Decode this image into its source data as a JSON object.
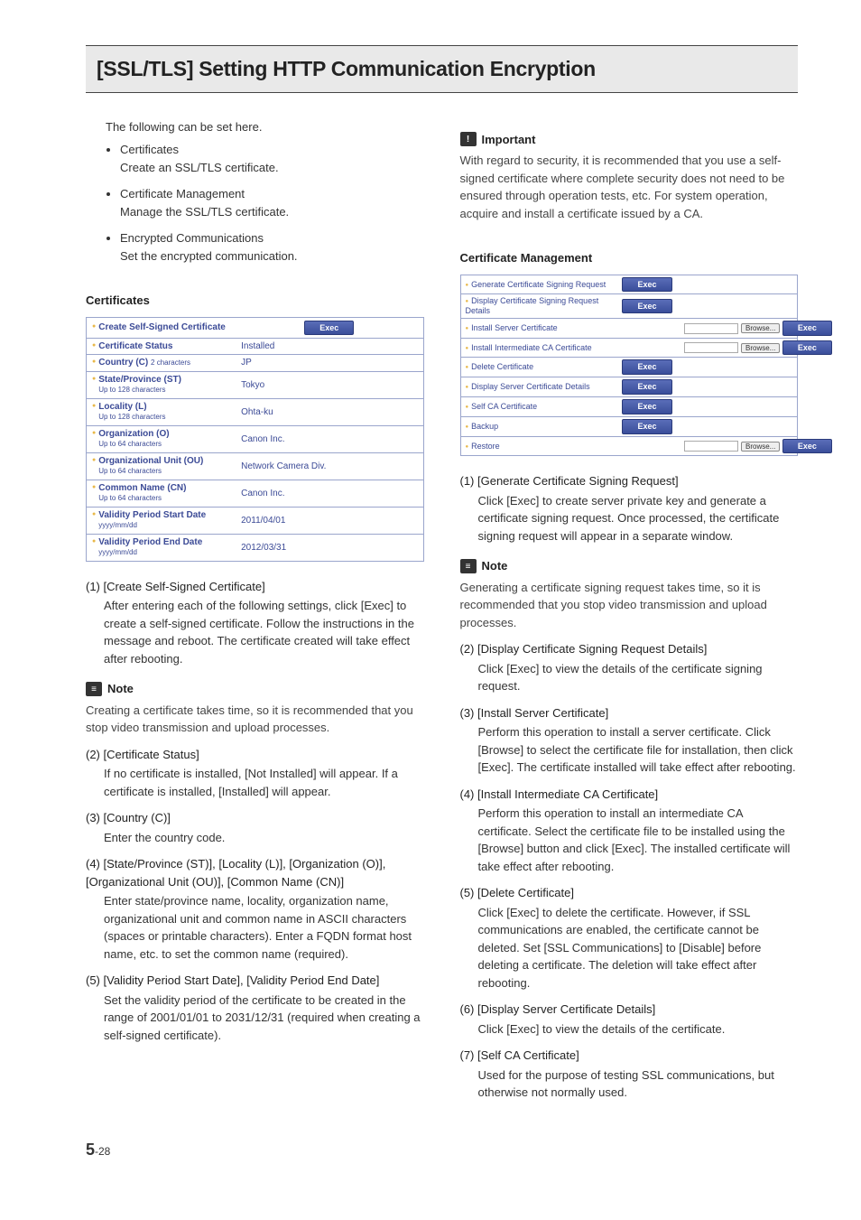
{
  "title": "[SSL/TLS] Setting HTTP Communication Encryption",
  "intro": "The following can be set here.",
  "bullets": [
    {
      "head": "Certificates",
      "sub": "Create an SSL/TLS certificate."
    },
    {
      "head": "Certificate Management",
      "sub": "Manage the SSL/TLS certificate."
    },
    {
      "head": "Encrypted Communications",
      "sub": "Set the encrypted communication."
    }
  ],
  "left": {
    "certificates_head": "Certificates",
    "table": {
      "rows": [
        {
          "label": "Create Self-Signed Certificate",
          "sub": "",
          "exec": true
        },
        {
          "label": "Certificate Status",
          "val": "Installed"
        },
        {
          "label": "Country (C)",
          "sub": "2 characters",
          "val": "JP"
        },
        {
          "label": "State/Province (ST)",
          "sub": "Up to 128 characters",
          "val": "Tokyo"
        },
        {
          "label": "Locality (L)",
          "sub": "Up to 128 characters",
          "val": "Ohta-ku"
        },
        {
          "label": "Organization (O)",
          "sub": "Up to 64 characters",
          "val": "Canon Inc."
        },
        {
          "label": "Organizational Unit (OU)",
          "sub": "Up to 64 characters",
          "val": "Network Camera Div."
        },
        {
          "label": "Common Name (CN)",
          "sub": "Up to 64 characters",
          "val": "Canon Inc."
        },
        {
          "label": "Validity Period Start Date",
          "sub": "yyyy/mm/dd",
          "val": "2011/04/01"
        },
        {
          "label": "Validity Period End Date",
          "sub": "yyyy/mm/dd",
          "val": "2012/03/31"
        }
      ],
      "exec_label": "Exec"
    },
    "items": {
      "i1": {
        "head": "(1) [Create Self-Signed Certificate]",
        "body": "After entering each of the following settings, click [Exec] to create a self-signed certificate. Follow the instructions in the message and reboot. The certificate created will take effect after rebooting."
      },
      "note1": {
        "title": "Note",
        "body": "Creating a certificate takes time, so it is recommended that you stop video transmission and upload processes."
      },
      "i2": {
        "head": "(2) [Certificate Status]",
        "body": "If no certificate is installed, [Not Installed] will appear. If a certificate is installed, [Installed] will appear."
      },
      "i3": {
        "head": "(3) [Country (C)]",
        "body": "Enter the country code."
      },
      "i4": {
        "head": "(4) [State/Province (ST)], [Locality (L)], [Organization (O)], [Organizational Unit (OU)], [Common Name (CN)]",
        "body": "Enter state/province name, locality, organization name, organizational unit and common name in ASCII characters (spaces or printable characters). Enter a FQDN format host name, etc. to set the common name (required)."
      },
      "i5": {
        "head": "(5) [Validity Period Start Date], [Validity Period End Date]",
        "body": "Set the validity period of the certificate to be created in the range of 2001/01/01 to 2031/12/31 (required when creating a self-signed certificate)."
      }
    }
  },
  "right": {
    "important": {
      "title": "Important",
      "body": "With regard to security, it is recommended that you use a self-signed certificate where complete security does not need to be ensured through operation tests, etc. For system operation, acquire and install a certificate issued by a CA."
    },
    "mgmt_head": "Certificate Management",
    "mgmt_table": {
      "exec_label": "Exec",
      "browse_label": "Browse...",
      "rows": [
        {
          "label": "Generate Certificate Signing Request",
          "exec": true
        },
        {
          "label": "Display Certificate Signing Request Details",
          "exec": true
        },
        {
          "label": "Install Server Certificate",
          "file": true
        },
        {
          "label": "Install Intermediate CA Certificate",
          "file": true
        },
        {
          "label": "Delete Certificate",
          "exec": true
        },
        {
          "label": "Display Server Certificate Details",
          "exec": true
        },
        {
          "label": "Self CA Certificate",
          "exec": true
        },
        {
          "label": "Backup",
          "exec": true
        },
        {
          "label": "Restore",
          "file": true
        }
      ]
    },
    "items": {
      "i1": {
        "head": "(1) [Generate Certificate Signing Request]",
        "body": "Click [Exec] to create server private key and generate a certificate signing request. Once processed, the certificate signing request will appear in a separate window."
      },
      "note1": {
        "title": "Note",
        "body": "Generating a certificate signing request takes time, so it is recommended that you stop video transmission and upload processes."
      },
      "i2": {
        "head": "(2) [Display Certificate Signing Request Details]",
        "body": "Click [Exec] to view the details of the certificate signing request."
      },
      "i3": {
        "head": "(3) [Install Server Certificate]",
        "body": "Perform this operation to install a server certificate. Click [Browse] to select the certificate file for installation, then click [Exec]. The certificate installed will take effect after rebooting."
      },
      "i4": {
        "head": "(4) [Install Intermediate CA Certificate]",
        "body": "Perform this operation to install an intermediate CA certificate. Select the certificate file to be installed using the [Browse] button and click [Exec]. The installed certificate will take effect after rebooting."
      },
      "i5": {
        "head": "(5) [Delete Certificate]",
        "body": "Click [Exec] to delete the certificate. However, if SSL communications are enabled, the certificate cannot be deleted. Set [SSL Communications] to [Disable] before deleting a certificate. The deletion will take effect after rebooting."
      },
      "i6": {
        "head": "(6) [Display Server Certificate Details]",
        "body": "Click [Exec] to view the details of the certificate."
      },
      "i7": {
        "head": "(7) [Self CA Certificate]",
        "body": "Used for the purpose of testing SSL communications, but otherwise not normally used."
      }
    }
  },
  "page": {
    "chapter": "5",
    "sub": "-28"
  }
}
